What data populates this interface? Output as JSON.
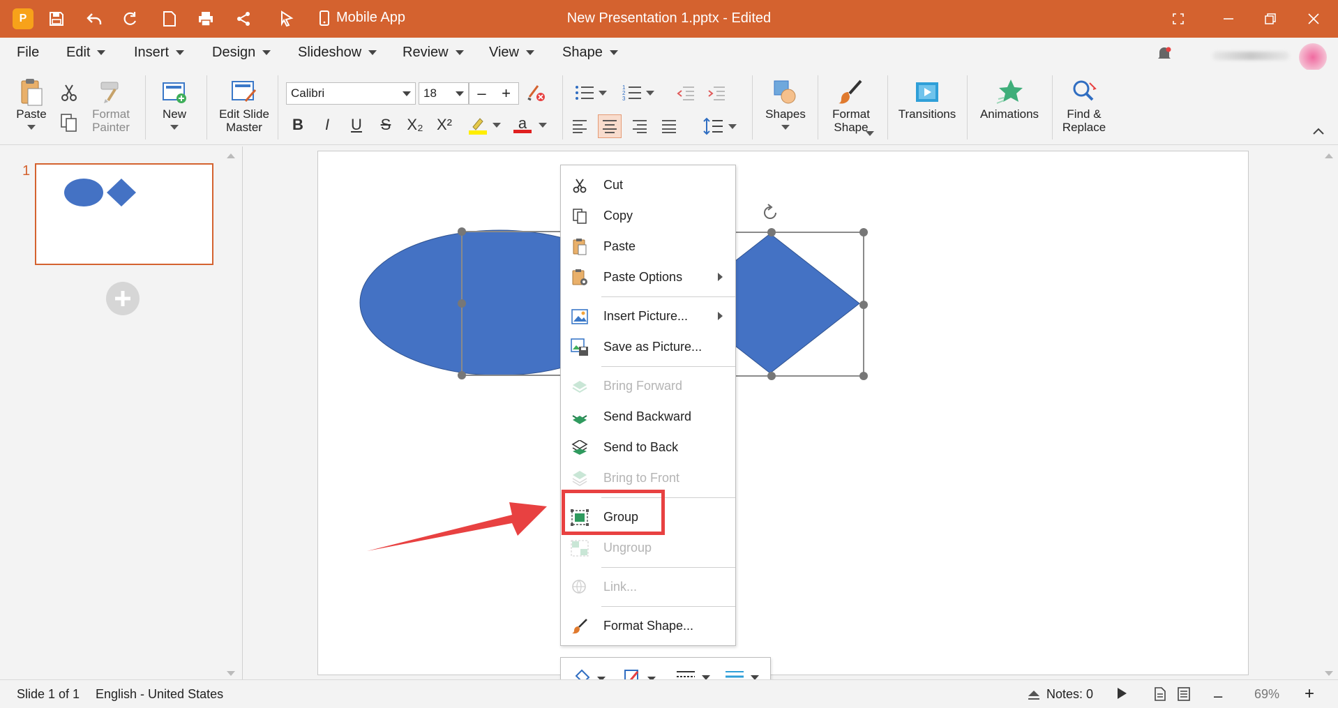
{
  "titlebar": {
    "mobile_label": "Mobile App",
    "doc_title": "New Presentation 1.pptx - Edited"
  },
  "menu": {
    "file": "File",
    "edit": "Edit",
    "insert": "Insert",
    "design": "Design",
    "slideshow": "Slideshow",
    "review": "Review",
    "view": "View",
    "shape": "Shape"
  },
  "ribbon": {
    "paste": "Paste",
    "format_painter": "Format Painter",
    "new": "New",
    "edit_slide_master": "Edit Slide Master",
    "font_name": "Calibri",
    "font_size": "18",
    "stepper_minus": "–",
    "stepper_plus": "+",
    "bold": "B",
    "italic": "I",
    "underline": "U",
    "strike": "S",
    "subscript": "X₂",
    "superscript": "X²",
    "font_color_glyph": "a",
    "shapes": "Shapes",
    "format_shape": "Format Shape",
    "transitions": "Transitions",
    "animations": "Animations",
    "find_replace": "Find & Replace"
  },
  "slidepane": {
    "slide_number": "1"
  },
  "context_menu": {
    "cut": "Cut",
    "copy": "Copy",
    "paste": "Paste",
    "paste_options": "Paste Options",
    "insert_picture": "Insert Picture...",
    "save_as_picture": "Save as Picture...",
    "bring_forward": "Bring Forward",
    "send_backward": "Send Backward",
    "send_to_back": "Send to Back",
    "bring_to_front": "Bring to Front",
    "group": "Group",
    "ungroup": "Ungroup",
    "link": "Link...",
    "format_shape": "Format Shape..."
  },
  "statusbar": {
    "slide_info": "Slide 1 of 1",
    "language": "English - United States",
    "notes": "Notes: 0",
    "zoom": "69%",
    "zoom_minus": "–",
    "zoom_plus": "+"
  },
  "colors": {
    "accent": "#d4622f",
    "shape_fill": "#4472c4",
    "highlight": "#e84141"
  }
}
